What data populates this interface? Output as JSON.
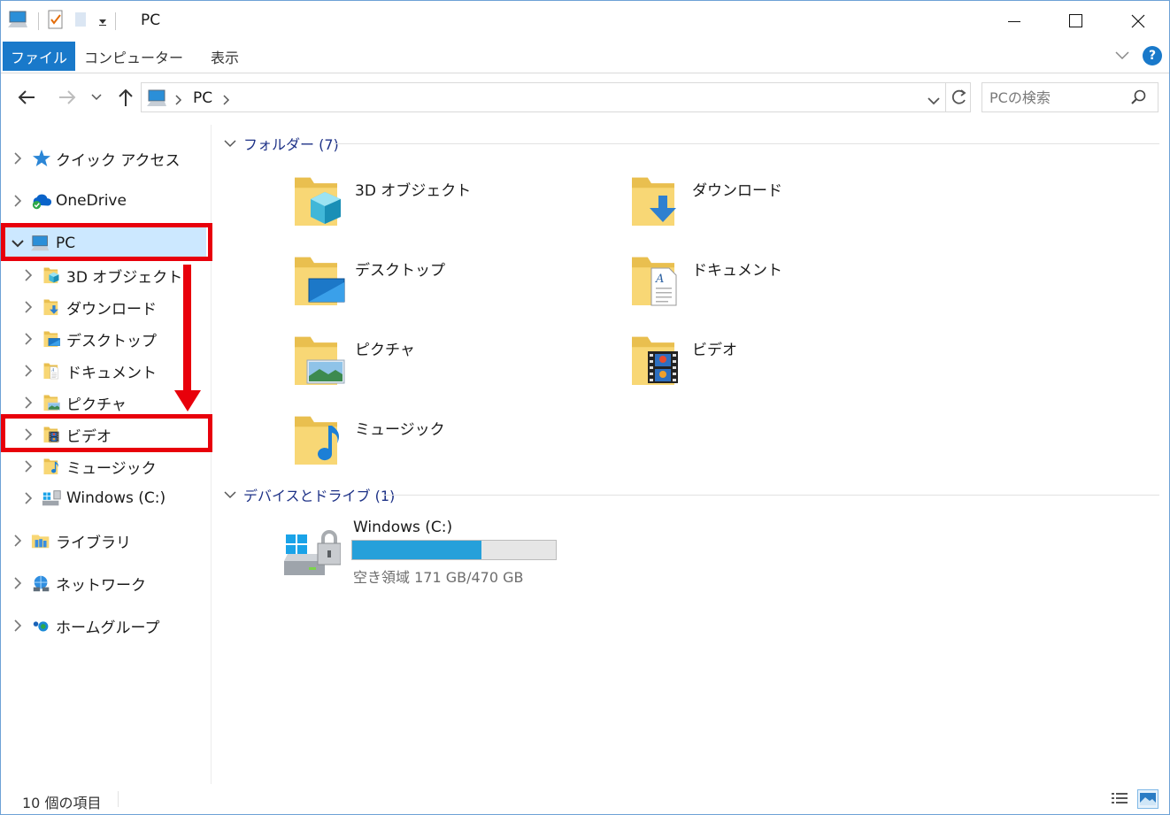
{
  "window": {
    "title": "PC"
  },
  "ribbon": {
    "tabs": [
      {
        "label": "ファイル"
      },
      {
        "label": "コンピューター"
      },
      {
        "label": "表示"
      }
    ],
    "help_label": "?"
  },
  "address": {
    "path": [
      "PC"
    ],
    "search_placeholder": "PCの検索"
  },
  "nav": {
    "items": [
      {
        "label": "クイック アクセス",
        "icon": "star-icon"
      },
      {
        "label": "OneDrive",
        "icon": "onedrive-cloud-icon"
      },
      {
        "label": "PC",
        "icon": "pc-icon",
        "selected": true,
        "expanded": true
      },
      {
        "label": "3D オブジェクト",
        "icon": "3d-objects-folder-icon"
      },
      {
        "label": "ダウンロード",
        "icon": "downloads-folder-icon"
      },
      {
        "label": "デスクトップ",
        "icon": "desktop-folder-icon"
      },
      {
        "label": "ドキュメント",
        "icon": "documents-folder-icon"
      },
      {
        "label": "ピクチャ",
        "icon": "pictures-folder-icon"
      },
      {
        "label": "ビデオ",
        "icon": "videos-folder-icon"
      },
      {
        "label": "ミュージック",
        "icon": "music-folder-icon"
      },
      {
        "label": "Windows (C:)",
        "icon": "drive-icon"
      },
      {
        "label": "ライブラリ",
        "icon": "libraries-icon"
      },
      {
        "label": "ネットワーク",
        "icon": "network-icon"
      },
      {
        "label": "ホームグループ",
        "icon": "homegroup-icon"
      }
    ]
  },
  "content": {
    "folders_header": "フォルダー (7)",
    "folders": [
      {
        "label": "3D オブジェクト",
        "icon": "3d-objects-folder-icon"
      },
      {
        "label": "ダウンロード",
        "icon": "downloads-folder-icon"
      },
      {
        "label": "デスクトップ",
        "icon": "desktop-folder-icon"
      },
      {
        "label": "ドキュメント",
        "icon": "documents-folder-icon"
      },
      {
        "label": "ピクチャ",
        "icon": "pictures-folder-icon"
      },
      {
        "label": "ビデオ",
        "icon": "videos-folder-icon"
      },
      {
        "label": "ミュージック",
        "icon": "music-folder-icon"
      }
    ],
    "drives_header": "デバイスとドライブ (1)",
    "drive": {
      "label": "Windows (C:)",
      "free_text": "空き領域 171 GB/470 GB",
      "used_fraction": 0.636
    }
  },
  "status": {
    "item_count": "10 個の項目"
  },
  "colors": {
    "accent": "#1979ca",
    "selection": "#cce8ff",
    "annotation_red": "#e8000b",
    "folder_yellow": "#f8d775",
    "drive_bar": "#26a0da"
  }
}
